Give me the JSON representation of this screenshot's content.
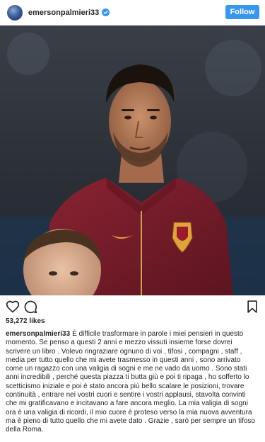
{
  "header": {
    "username": "emersonpalmieri33",
    "avatar_icon": "profile-avatar",
    "verified_icon": "verified-badge-icon",
    "follow_label": "Follow"
  },
  "post": {
    "image_icon": "player-photo",
    "actions": {
      "like_icon": "heart-icon",
      "comment_icon": "comment-icon",
      "save_icon": "bookmark-icon"
    },
    "likes": "53,272 likes",
    "caption": {
      "username": "emersonpalmieri33",
      "text": "È difficile trasformare in parole i miei pensieri in questo momento. Se penso a questi 2 anni e mezzo vissuti insieme forse dovrei scrivere un libro . Volevo ringraziare ognuno di voi , tifosi , compagni , staff , media per tutto quello che mi avete trasmesso in questi anni , sono arrivato come un ragazzo con una valigia di sogni e me ne vado da uomo . Sono stati anni incredibili , perché questa piazza ti butta giù e poi ti ripaga , ho sofferto lo scetticismo iniziale e poi è stato ancora più bello scalare le posizioni, trovare continuità , entrare nei vostri cuori e sentire i vostri applausi, stavolta convinti che mi gratificavano e incitavano a fare ancora meglio. La mia valigia di sogni ora è una valigia di ricordi, il mio cuore è proteso verso la mia nuova avventura ma è pieno di tutto quello che mi avete dato . Grazie , sarò per sempre un tifoso della Roma."
    }
  },
  "colors": {
    "follow_button": "#3897f0",
    "jersey": "#7a1f2b",
    "text": "#262626"
  }
}
